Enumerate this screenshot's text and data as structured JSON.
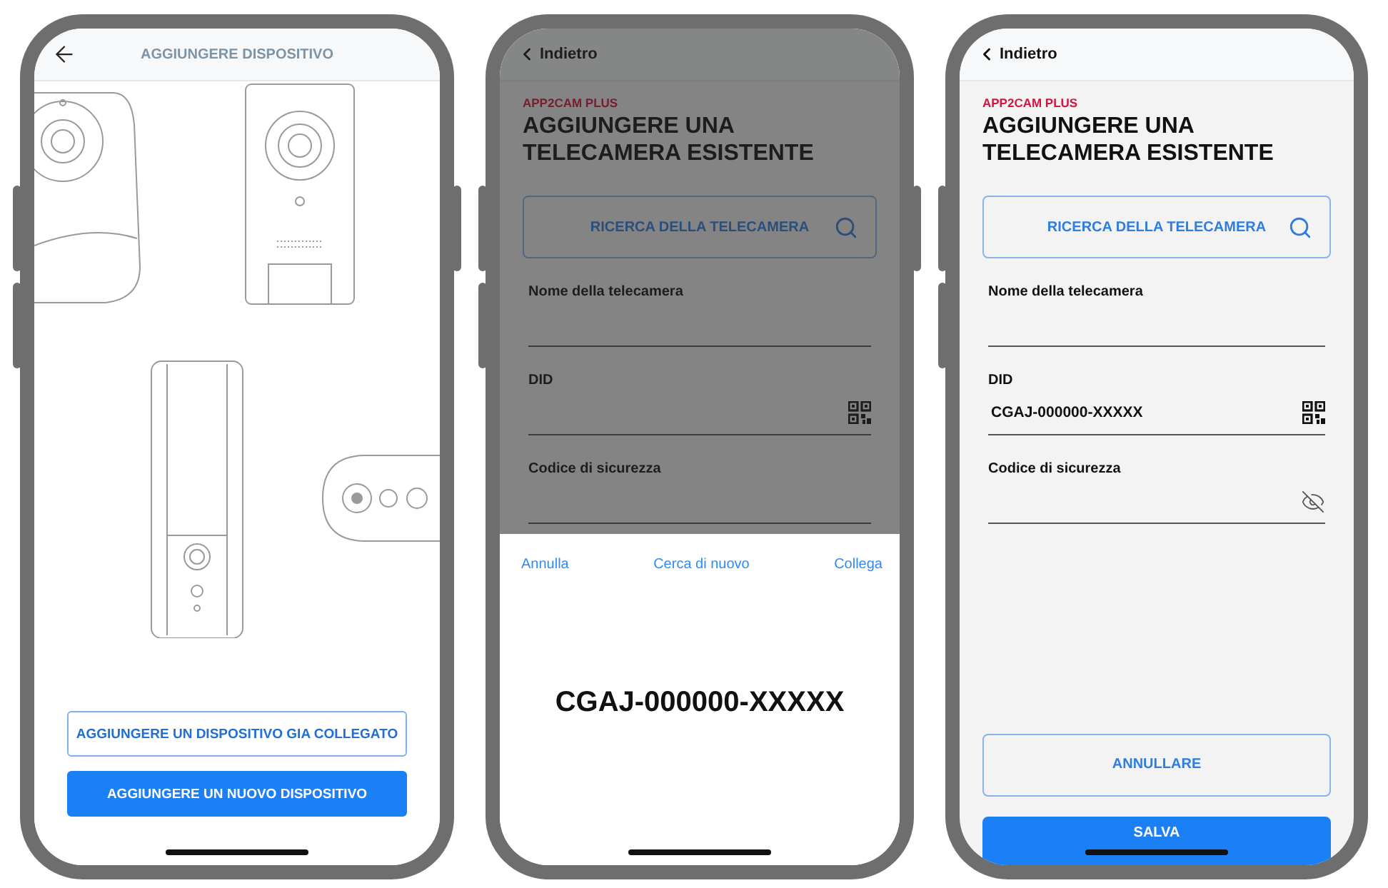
{
  "screens": [
    {
      "kind": "device_picker",
      "title": "AGGIUNGERE DISPOSITIVO",
      "buttons": [
        {
          "label": "AGGIUNGERE UN DISPOSITIVO GIA COLLEGATO",
          "primary": false
        },
        {
          "label": "AGGIUNGERE UN NUOVO DISPOSITIVO",
          "primary": true
        }
      ]
    },
    {
      "kind": "form",
      "dimmed": true,
      "back": "Indietro",
      "brand": "APP2CAM PLUS",
      "heading": "AGGIUNGERE UNA TELECAMERA ESISTENTE",
      "search_button": "RICERCA DELLA TELECAMERA",
      "fields": [
        {
          "label": "Nome della telecamera",
          "kind": "text"
        },
        {
          "label": "DID",
          "kind": "qr"
        },
        {
          "label": "Codice di sicurezza",
          "kind": "text"
        }
      ],
      "sheet": {
        "actions": [
          "Annulla",
          "Cerca di nuovo",
          "Collega"
        ],
        "value": "CGAJ-000000-XXXXX"
      }
    },
    {
      "kind": "form",
      "dimmed": false,
      "back": "Indietro",
      "brand": "APP2CAM PLUS",
      "heading": "AGGIUNGERE UNA TELECAMERA ESISTENTE",
      "search_button": "RICERCA DELLA TELECAMERA",
      "fields": [
        {
          "label": "Nome della telecamera",
          "kind": "text"
        },
        {
          "label": "DID",
          "kind": "qr",
          "value": "CGAJ-000000-XXXXX"
        },
        {
          "label": "Codice di sicurezza",
          "kind": "secret"
        }
      ],
      "buttons": [
        {
          "label": "ANNULLARE",
          "primary": false
        },
        {
          "label": "SALVA",
          "primary": true
        }
      ]
    }
  ]
}
